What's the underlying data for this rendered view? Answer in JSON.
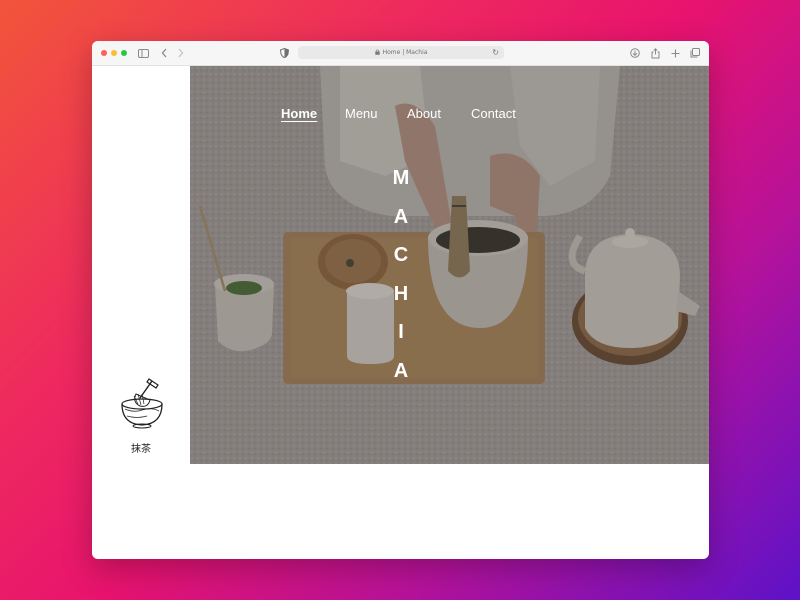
{
  "browser": {
    "address": "Home | Machia",
    "icons": {
      "sidebar": "sidebar-icon",
      "back": "chevron-left-icon",
      "forward": "chevron-right-icon",
      "shield": "shield-icon",
      "lock": "lock-icon",
      "reload": "reload-icon",
      "download": "download-icon",
      "share": "share-icon",
      "new_tab": "plus-icon",
      "tabs": "tabs-overview-icon"
    }
  },
  "nav": {
    "items": [
      {
        "label": "Home",
        "active": true
      },
      {
        "label": "Menu",
        "active": false
      },
      {
        "label": "About",
        "active": false
      },
      {
        "label": "Contact",
        "active": false
      }
    ]
  },
  "hero": {
    "brand_letters": [
      "M",
      "A",
      "C",
      "H",
      "I",
      "A"
    ]
  },
  "sidebar": {
    "logo_icon": "matcha-bowl-whisk-icon",
    "logo_label": "抹茶"
  },
  "colors": {
    "nav_text": "#ffffff",
    "hero_overlay": "#7d7875",
    "page_background": "#ffffff"
  }
}
